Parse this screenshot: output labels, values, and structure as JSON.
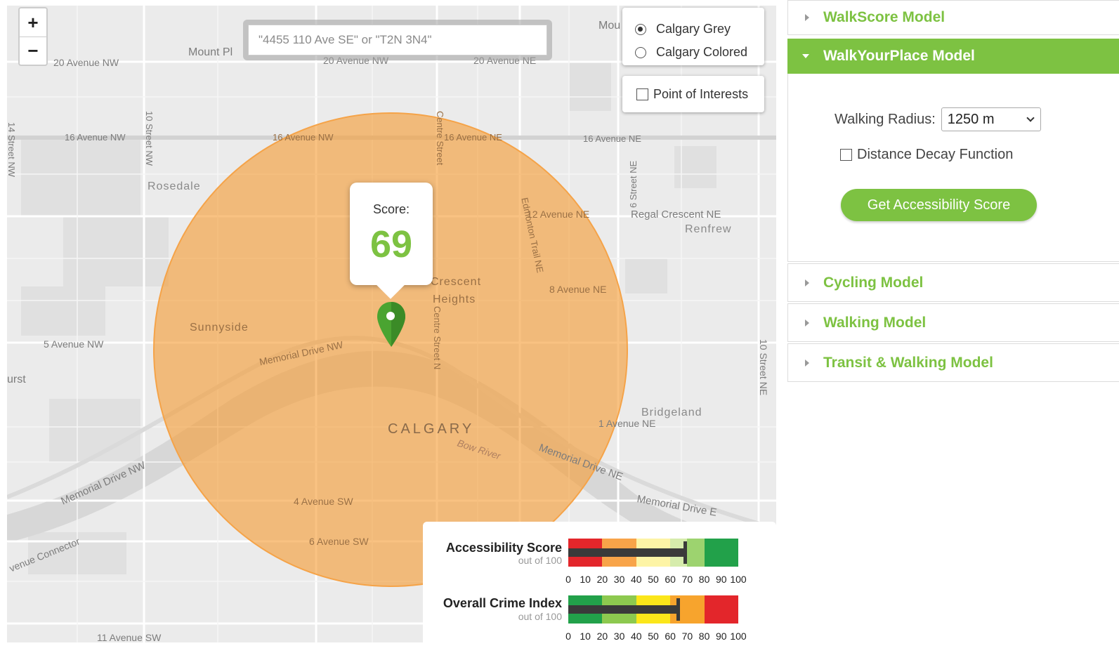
{
  "map": {
    "zoom_in": "+",
    "zoom_out": "−",
    "search_placeholder": "\"4455 110 Ave SE\" or \"T2N 3N4\"",
    "layers": [
      {
        "label": "Calgary Grey",
        "selected": true
      },
      {
        "label": "Calgary Colored",
        "selected": false
      }
    ],
    "poi_label": "Point of Interests",
    "popup": {
      "label": "Score:",
      "value": "69"
    },
    "labels": {
      "l1": "20 Avenue NW",
      "l2": "Mount Pl",
      "l3": "20 Avenue NW",
      "l4": "20 Avenue NE",
      "l5": "Mou",
      "l6": "16 Avenue NW",
      "l7": "16 Avenue NW",
      "l8": "16 Avenue NE",
      "l9": "16 Avenue NE",
      "l10": "Rosedale",
      "l11": "12 Avenue NE",
      "l12": "Regal Crescent NE",
      "l13": "Renfrew",
      "l14": "Crescent",
      "l15": "Heights",
      "l16": "8 Avenue NE",
      "l17": "Sunnyside",
      "l18": "Memorial Drive NW",
      "l19": "5 Avenue NW",
      "l20": "urst",
      "l21": "CALGARY",
      "l22": "Bridgeland",
      "l23": "1 Avenue NE",
      "l24": "Bow River",
      "l25": "Memorial Drive NW",
      "l26": "Memorial Drive NE",
      "l27": "Memorial Drive E",
      "l28": "4 Avenue SW",
      "l29": "6 Avenue SW",
      "l30": "venue Connector",
      "l31": "11 Avenue SW",
      "v1": "14 Street NW",
      "v2": "10 Street NW",
      "v3": "Centre Street",
      "v4": "Edmonton Trail NE",
      "v5": "6 Street NE",
      "v6": "Centre Street N",
      "v7": "10 Street NE"
    },
    "legend": {
      "accessibility": {
        "title": "Accessibility Score",
        "sub": "out of 100",
        "value": 69
      },
      "crime": {
        "title": "Overall Crime Index",
        "sub": "out of 100",
        "value": 65
      },
      "ticks": [
        "0",
        "10",
        "20",
        "30",
        "40",
        "50",
        "60",
        "70",
        "80",
        "90",
        "100"
      ],
      "accessibility_colors": [
        "#e3262b",
        "#f8a449",
        "#fdf4a6",
        "#d6ecac",
        "#9dd36f",
        "#22a14a"
      ],
      "crime_colors": [
        "#22a14a",
        "#8dc94f",
        "#fbe61a",
        "#f7a42d",
        "#e3262b"
      ]
    }
  },
  "sidebar": {
    "walkscore": "WalkScore Model",
    "walkyourplace": "WalkYourPlace Model",
    "radius_label": "Walking Radius:",
    "radius_value": "1250 m",
    "decay_label": "Distance Decay Function",
    "score_button": "Get Accessibility Score",
    "cycling": "Cycling Model",
    "walking": "Walking Model",
    "transit": "Transit & Walking Model"
  }
}
